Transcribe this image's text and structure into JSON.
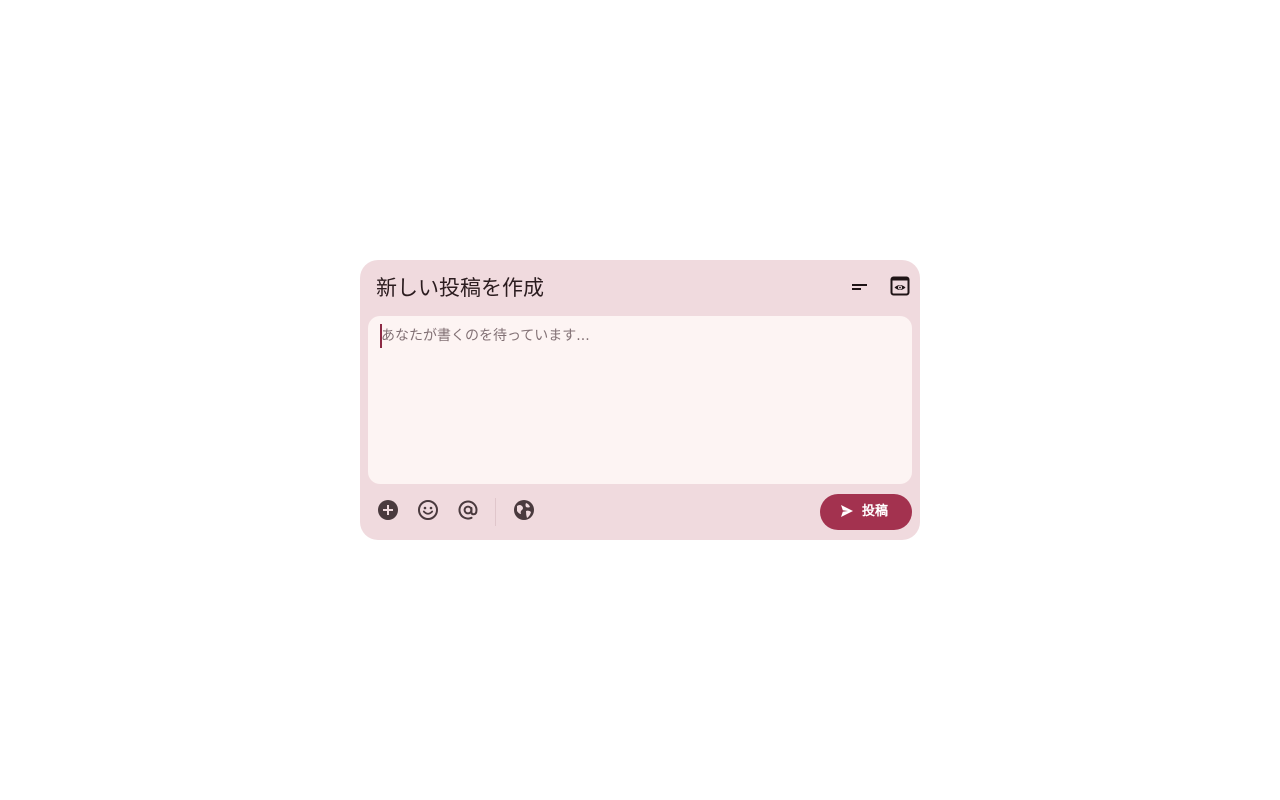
{
  "composer": {
    "title": "新しい投稿を作成",
    "placeholder": "あなたが書くのを待っています...",
    "post_label": "投稿"
  },
  "icons": {
    "minimize": "minimize-icon",
    "preview": "preview-icon",
    "add": "add-circle-icon",
    "emoji": "emoji-icon",
    "mention": "at-sign-icon",
    "visibility": "globe-icon",
    "send": "send-icon"
  },
  "colors": {
    "panel": "#f0dade",
    "editor": "#fdf4f3",
    "accent": "#a3324f",
    "icon": "#4a3a3e",
    "caret": "#8d2a45"
  }
}
